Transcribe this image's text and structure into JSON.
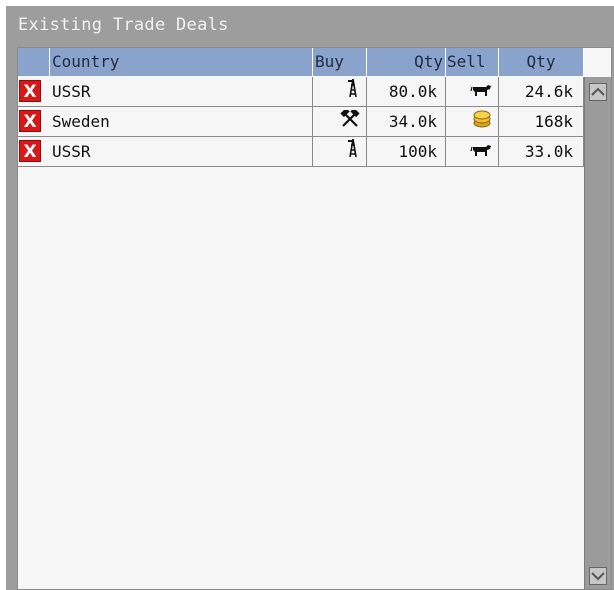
{
  "panel": {
    "title": "Existing Trade Deals"
  },
  "table": {
    "headers": {
      "country": "Country",
      "buy": "Buy",
      "buy_qty": "Qty",
      "sell": "Sell",
      "sell_qty": "Qty"
    },
    "rows": [
      {
        "delete_label": "X",
        "country": "USSR",
        "buy_icon": "oil-derrick-icon",
        "buy_qty": "80.0k",
        "sell_icon": "cattle-icon",
        "sell_qty": "24.6k"
      },
      {
        "delete_label": "X",
        "country": "Sweden",
        "buy_icon": "crossed-hammers-icon",
        "buy_qty": "34.0k",
        "sell_icon": "gold-coins-icon",
        "sell_qty": "168k"
      },
      {
        "delete_label": "X",
        "country": "USSR",
        "buy_icon": "oil-derrick-icon",
        "buy_qty": "100k",
        "sell_icon": "cattle-icon",
        "sell_qty": "33.0k"
      }
    ]
  },
  "colors": {
    "panel_bg": "#9d9d9d",
    "header_bg": "#8aa3cc",
    "delete_red": "#d81818",
    "table_bg": "#f6f6f6"
  }
}
